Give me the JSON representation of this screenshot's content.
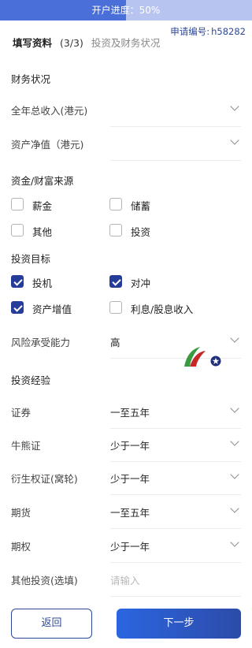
{
  "header": {
    "progress_label": "开户进度：50%",
    "progress_fraction": 0.5,
    "app_id_label": "申请编号:",
    "app_id": "h58282",
    "title": "填写资料",
    "step": "(3/3)",
    "subtitle": "投资及财务状况"
  },
  "financial": {
    "section": "财务状况",
    "annual_income_label": "全年总收入(港元)",
    "net_assets_label": "资产净值（港元)"
  },
  "funds": {
    "section": "资金/财富来源",
    "options": [
      {
        "label": "薪金",
        "checked": false
      },
      {
        "label": "储蓄",
        "checked": false
      },
      {
        "label": "其他",
        "checked": false
      },
      {
        "label": "投资",
        "checked": false
      }
    ]
  },
  "goals": {
    "section": "投资目标",
    "options": [
      {
        "label": "投机",
        "checked": true
      },
      {
        "label": "对冲",
        "checked": true
      },
      {
        "label": "资产增值",
        "checked": true
      },
      {
        "label": "利息/股息收入",
        "checked": false
      }
    ]
  },
  "risk": {
    "label": "风险承受能力",
    "value": "高"
  },
  "experience": {
    "section": "投资经验",
    "rows": [
      {
        "label": "证券",
        "value": "一至五年"
      },
      {
        "label": "牛熊证",
        "value": "少于一年"
      },
      {
        "label": "衍生权证(窝轮)",
        "value": "少于一年"
      },
      {
        "label": "期货",
        "value": "一至五年"
      },
      {
        "label": "期权",
        "value": "少于一年"
      }
    ],
    "other_label": "其他投资(选填)",
    "other_placeholder": "请输入"
  },
  "buttons": {
    "back": "返回",
    "next": "下一步"
  },
  "colors": {
    "accent": "#263c99",
    "progress_fill": "#4a6fd8",
    "progress_bg": "#b7c4ef"
  }
}
